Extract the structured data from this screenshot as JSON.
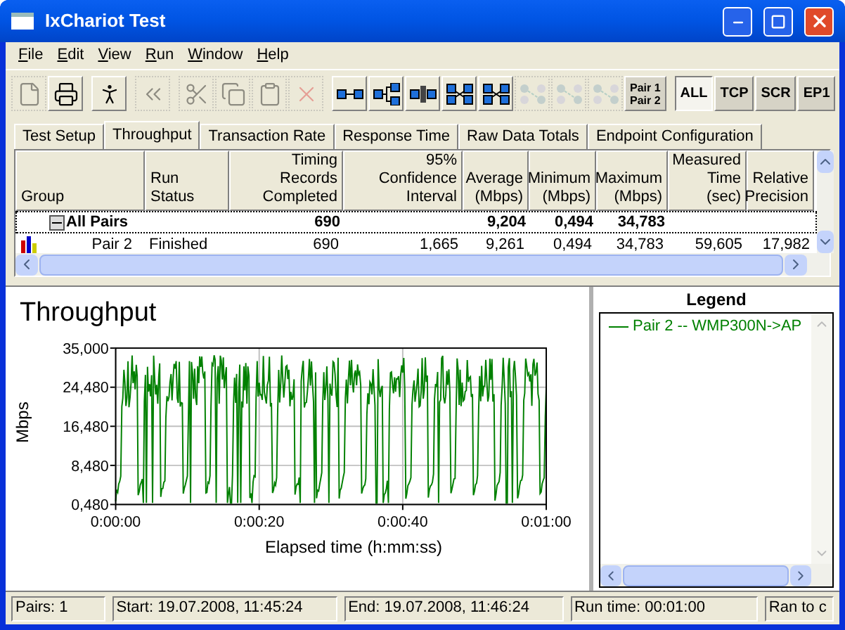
{
  "window": {
    "title": "IxChariot Test"
  },
  "menu": [
    {
      "label": "File"
    },
    {
      "label": "Edit"
    },
    {
      "label": "View"
    },
    {
      "label": "Run"
    },
    {
      "label": "Window"
    },
    {
      "label": "Help"
    }
  ],
  "toolbar_groups": [
    [
      {
        "kind": "icon",
        "disabled": true
      },
      {
        "kind": "icon",
        "disabled": false
      }
    ],
    [
      {
        "kind": "icon",
        "disabled": false
      }
    ],
    [
      {
        "kind": "icon",
        "disabled": true
      }
    ],
    [
      {
        "kind": "icon",
        "disabled": true
      },
      {
        "kind": "icon",
        "disabled": true
      },
      {
        "kind": "icon",
        "disabled": true
      },
      {
        "kind": "icon",
        "disabled": true
      }
    ],
    [
      {
        "kind": "icon",
        "disabled": false
      },
      {
        "kind": "icon",
        "disabled": false
      },
      {
        "kind": "icon",
        "disabled": false
      },
      {
        "kind": "icon",
        "disabled": false
      },
      {
        "kind": "icon",
        "disabled": false
      },
      {
        "kind": "icon",
        "disabled": true
      },
      {
        "kind": "icon",
        "disabled": true
      },
      {
        "kind": "icon",
        "disabled": true
      },
      {
        "kind": "text",
        "lines": [
          "Pair 1",
          "Pair 2"
        ],
        "selected": false
      }
    ],
    [
      {
        "kind": "text",
        "lines": [
          "ALL"
        ],
        "selected": true
      },
      {
        "kind": "text",
        "lines": [
          "TCP"
        ],
        "selected": false
      },
      {
        "kind": "text",
        "lines": [
          "SCR"
        ],
        "selected": false
      },
      {
        "kind": "text",
        "lines": [
          "EP1"
        ],
        "selected": false
      }
    ]
  ],
  "tabs": [
    {
      "label": "Test Setup",
      "selected": false
    },
    {
      "label": "Throughput",
      "selected": true
    },
    {
      "label": "Transaction Rate",
      "selected": false
    },
    {
      "label": "Response Time",
      "selected": false
    },
    {
      "label": "Raw Data Totals",
      "selected": false
    },
    {
      "label": "Endpoint Configuration",
      "selected": false
    }
  ],
  "table": {
    "columns": [
      "Group",
      "Run Status",
      "Timing Records Completed",
      "95% Confidence Interval",
      "Average (Mbps)",
      "Minimum (Mbps)",
      "Maximum (Mbps)",
      "Measured Time (sec)",
      "Relative Precision"
    ],
    "rows": [
      {
        "kind": "group",
        "expanded": true,
        "cells": [
          "All Pairs",
          "",
          "690",
          "",
          "9,204",
          "0,494",
          "34,783",
          "",
          ""
        ]
      },
      {
        "kind": "pair",
        "cells": [
          "Pair 2",
          "Finished",
          "690",
          "1,665",
          "9,261",
          "0,494",
          "34,783",
          "59,605",
          "17,982"
        ]
      }
    ]
  },
  "chart": {
    "title": "Throughput",
    "ylabel": "Mbps",
    "xlabel": "Elapsed time (h:mm:ss)",
    "yticks": [
      "35,000",
      "24,480",
      "16,480",
      "8,480",
      "0,480"
    ],
    "xticks": [
      "0:00:00",
      "0:00:20",
      "0:00:40",
      "0:01:00"
    ]
  },
  "legend": {
    "title": "Legend",
    "items": [
      {
        "label": "Pair 2 -- WMP300N->AP",
        "color": "#008000"
      }
    ]
  },
  "status_bar": [
    "Pairs: 1",
    "Start: 19.07.2008, 11:45:24",
    "End: 19.07.2008, 11:46:24",
    "Run time: 00:01:00",
    "Ran to c"
  ]
}
